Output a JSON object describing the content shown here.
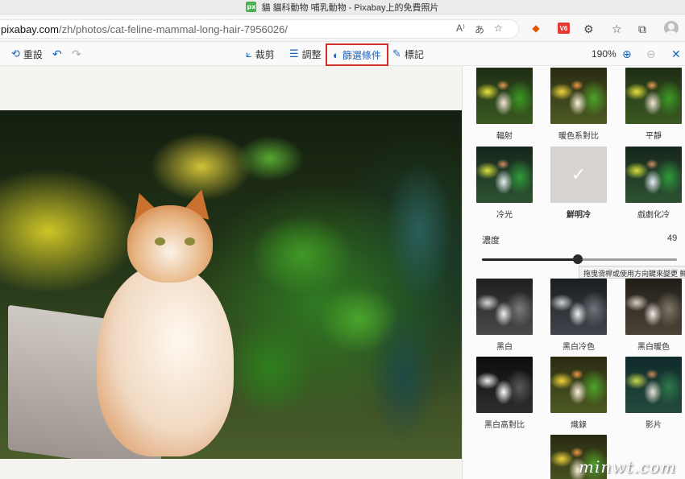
{
  "window": {
    "title": "貓 貓科動物 哺乳動物 - Pixabay上的免費照片",
    "favicon_text": "px"
  },
  "address_bar": {
    "url_host": "pixabay.com",
    "url_path": "/zh/photos/cat-feline-mammal-long-hair-7956026/",
    "icons": [
      "read-aloud-icon",
      "translate-icon",
      "favorite-icon"
    ],
    "extensions": [
      "extension-orange-icon",
      "extension-red-icon",
      "extensions-puzzle-icon",
      "favorites-icon",
      "collections-icon",
      "profile-avatar"
    ],
    "ext_red_label": "V6"
  },
  "toolbar": {
    "reset_label": "重設",
    "undo_icon": "undo-icon",
    "redo_icon": "redo-icon",
    "crop_label": "裁剪",
    "adjust_label": "調整",
    "filter_label": "篩選條件",
    "markup_label": "標記",
    "zoom_level": "190%",
    "zoom_in_icon": "zoom-in-icon",
    "zoom_out_icon": "zoom-out-icon",
    "close_icon": "close-icon",
    "accent_color": "#1565c0",
    "highlight_border_color": "#d32f2f"
  },
  "panel": {
    "filters_top": [
      {
        "label": "輻射",
        "style": "color"
      },
      {
        "label": "暖色系對比",
        "style": "warm"
      },
      {
        "label": "平靜",
        "style": "color"
      },
      {
        "label": "冷光",
        "style": "cool"
      },
      {
        "label": "鮮明冷",
        "style": "selected"
      },
      {
        "label": "戲劇化冷",
        "style": "cool"
      }
    ],
    "intensity": {
      "label": "濃度",
      "value": 49,
      "value_text": "49",
      "tooltip": "拖曳滑桿或使用方向鍵來變更 鮮明"
    },
    "filters_bottom": [
      {
        "label": "黑白",
        "style": "bw"
      },
      {
        "label": "黑白冷色",
        "style": "bwcool"
      },
      {
        "label": "黑白暖色",
        "style": "bwwarm"
      },
      {
        "label": "黑白高對比",
        "style": "bwhigh"
      },
      {
        "label": "熾錄",
        "style": "warm"
      },
      {
        "label": "影片",
        "style": "film"
      }
    ]
  },
  "watermark": "minwt.com"
}
